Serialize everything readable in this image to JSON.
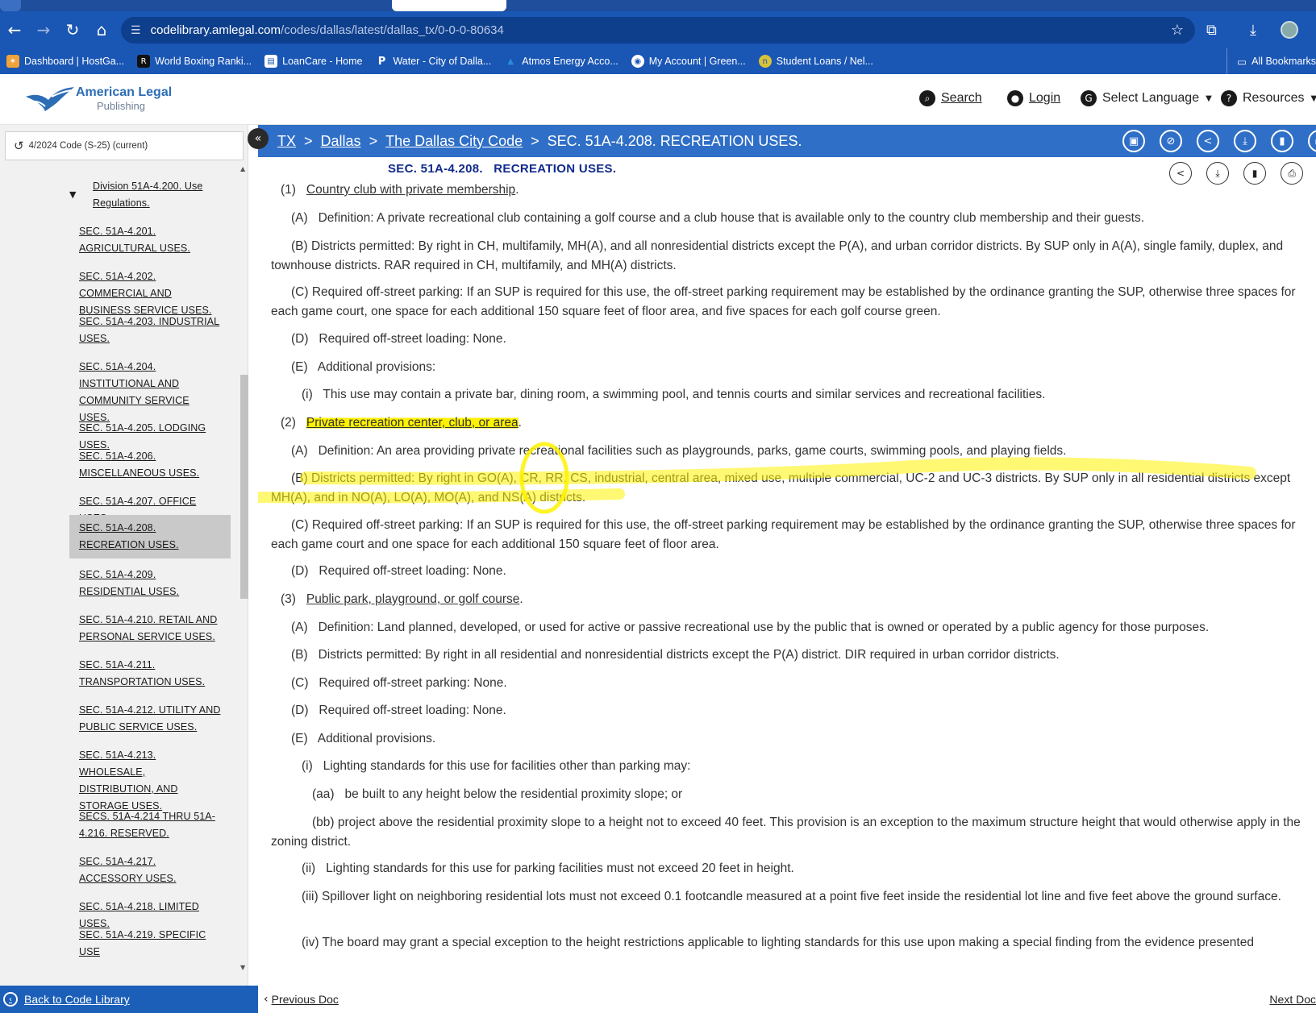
{
  "browser": {
    "url_host": "codelibrary.amlegal.com",
    "url_path": "/codes/dallas/latest/dallas_tx/0-0-0-80634",
    "bookmarks": [
      {
        "label": "Dashboard | HostGa...",
        "icon": "hostgator-icon"
      },
      {
        "label": "World Boxing Ranki...",
        "icon": "boxing-icon"
      },
      {
        "label": "LoanCare - Home",
        "icon": "bookmark-page-icon"
      },
      {
        "label": "Water - City of Dalla...",
        "icon": "p-icon"
      },
      {
        "label": "Atmos Energy Acco...",
        "icon": "atmos-icon"
      },
      {
        "label": "My Account | Green...",
        "icon": "globe-icon"
      },
      {
        "label": "Student Loans / Nel...",
        "icon": "nelnet-icon"
      }
    ],
    "all_bookmarks": "All Bookmarks"
  },
  "header": {
    "logo_line1": "American Legal",
    "logo_line2": "Publishing",
    "search": "Search",
    "login": "Login",
    "language": "Select Language",
    "resources": "Resources"
  },
  "sidebar": {
    "version": "4/2024 Code (S-25) (current)",
    "division": "Division 51A-4.200. Use Regulations.",
    "items": [
      {
        "label": "SEC. 51A-4.201. AGRICULTURAL USES."
      },
      {
        "label": "SEC. 51A-4.202. COMMERCIAL AND BUSINESS SERVICE USES."
      },
      {
        "label": "SEC. 51A-4.203. INDUSTRIAL USES."
      },
      {
        "label": "SEC. 51A-4.204. INSTITUTIONAL AND COMMUNITY SERVICE USES."
      },
      {
        "label": "SEC. 51A-4.205. LODGING USES."
      },
      {
        "label": "SEC. 51A-4.206. MISCELLANEOUS USES."
      },
      {
        "label": "SEC. 51A-4.207. OFFICE USES."
      },
      {
        "label": "SEC. 51A-4.208. RECREATION USES."
      },
      {
        "label": "SEC. 51A-4.209. RESIDENTIAL USES."
      },
      {
        "label": "SEC. 51A-4.210. RETAIL AND PERSONAL SERVICE USES."
      },
      {
        "label": "SEC. 51A-4.211. TRANSPORTATION USES."
      },
      {
        "label": "SEC. 51A-4.212. UTILITY AND PUBLIC SERVICE USES."
      },
      {
        "label": "SEC. 51A-4.213. WHOLESALE, DISTRIBUTION, AND STORAGE USES."
      },
      {
        "label": "SECS. 51A-4.214 THRU 51A-4.216. RESERVED."
      },
      {
        "label": "SEC. 51A-4.217. ACCESSORY USES."
      },
      {
        "label": "SEC. 51A-4.218. LIMITED USES."
      },
      {
        "label": "SEC. 51A-4.219. SPECIFIC USE"
      }
    ],
    "back_to_library": "Back to Code Library"
  },
  "breadcrumb": {
    "tx": "TX",
    "dallas": "Dallas",
    "code": "The Dallas City Code",
    "current": "SEC. 51A-4.208. RECREATION USES."
  },
  "document": {
    "title": "SEC. 51A-4.208.   RECREATION USES.",
    "p1_num": "(1)",
    "p1_title": "Country club with private membership",
    "p1_A": "(A)   Definition: A private recreational club containing a golf course and a club house that is available only to the country club membership and their guests.",
    "p1_B": "(B)   Districts permitted: By right in CH, multifamily, MH(A), and all nonresidential districts except the P(A), and urban corridor districts. By SUP only in A(A), single family, duplex, and townhouse districts. RAR required in CH, multifamily, and MH(A) districts.",
    "p1_C": "(C)   Required off-street parking: If an SUP is required for this use, the off-street parking requirement may be established by the ordinance granting the SUP, otherwise three spaces for each game court, one space for each additional 150 square feet of floor area, and five spaces for each golf course green.",
    "p1_D": "(D)   Required off-street loading: None.",
    "p1_E": "(E)   Additional provisions:",
    "p1_Ei": "(i)   This use may contain a private bar, dining room, a swimming pool, and tennis courts and similar services and recreational facilities.",
    "p2_num": "(2)",
    "p2_title": "Private recreation center, club, or area",
    "p2_A": "(A)   Definition: An area providing private recreational facilities such as playgrounds, parks, game courts, swimming pools, and playing fields.",
    "p2_B": "(B)   Districts permitted: By right in GO(A), CR, RR, CS, industrial, central area, mixed use, multiple commercial, UC-2 and UC-3 districts. By SUP only in all residential districts except MH(A), and in NO(A), LO(A), MO(A), and NS(A) districts.",
    "p2_C": "(C)   Required off-street parking: If an SUP is required for this use, the off-street parking requirement may be established by the ordinance granting the SUP, otherwise three spaces for each game court and one space for each additional 150 square feet of floor area.",
    "p2_D": "(D)   Required off-street loading: None.",
    "p3_num": "(3)",
    "p3_title": "Public park, playground, or golf course",
    "p3_A": "(A)   Definition: Land planned, developed, or used for active or passive recreational use by the public that is owned or operated by a public agency for those purposes.",
    "p3_B": "(B)   Districts permitted: By right in all residential and nonresidential districts except the P(A) district. DIR required in urban corridor districts.",
    "p3_C": "(C)   Required off-street parking: None.",
    "p3_D": "(D)   Required off-street loading: None.",
    "p3_E": "(E)   Additional provisions.",
    "p3_Ei": "(i)   Lighting standards for this use for facilities other than parking may:",
    "p3_Ei_aa": "(aa)   be built to any height below the residential proximity slope; or",
    "p3_Ei_bb": "(bb)   project above the residential proximity slope to a height not to exceed 40 feet. This provision is an exception to the maximum structure height that would otherwise apply in the zoning district.",
    "p3_Eii": "(ii)   Lighting standards for this use for parking facilities must not exceed 20 feet in height.",
    "p3_Eiii": "(iii)   Spillover light on neighboring residential lots must not exceed 0.1 footcandle measured at a point five feet inside the residential lot line and five feet above the ground surface.",
    "p3_Eiv": "(iv)   The board may grant a special exception to the height restrictions applicable to lighting standards for this use upon making a special finding from the evidence presented"
  },
  "footer": {
    "prev": "Previous Doc",
    "next": "Next Doc"
  },
  "colors": {
    "chrome_blue": "#1a56b4",
    "breadcrumb_blue": "#2f6fc7",
    "highlight_yellow": "#fff200",
    "title_navy": "#102a8c"
  }
}
